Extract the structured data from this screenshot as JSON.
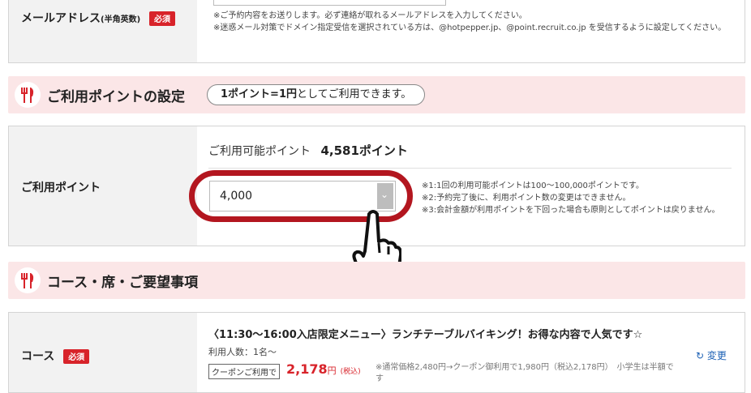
{
  "email": {
    "label": "メールアドレス",
    "label_small": "(半角英数)",
    "required": "必須",
    "note1": "※ご予約内容をお送りします。必ず連絡が取れるメールアドレスを入力してください。",
    "note2": "※迷惑メール対策でドメイン指定受信を選択されている方は、@hotpepper.jp、@point.recruit.co.jp を受信するように設定してください。"
  },
  "points_section": {
    "title": "ご利用ポイントの設定",
    "pill_bold": "1ポイント=1円",
    "pill_rest": "としてご利用できます。"
  },
  "points_row": {
    "label": "ご利用ポイント",
    "available_label": "ご利用可能ポイント",
    "available_value": "4,581ポイント",
    "selected_value": "4,000",
    "note1": "※1:1回の利用可能ポイントは100〜100,000ポイントです。",
    "note2": "※2:予約完了後に、利用ポイント数の変更はできません。",
    "note3": "※3:会計金額が利用ポイントを下回った場合も原則としてポイントは戻りません。"
  },
  "course_section": {
    "title": "コース・席・ご要望事項"
  },
  "course_row": {
    "label": "コース",
    "required": "必須",
    "name": "〈11:30〜16:00入店限定メニュー〉ランチテーブルバイキング！お得な内容で人気です☆",
    "people": "利用人数：1名〜",
    "coupon_tag": "クーポンご利用で",
    "price": "2,178",
    "yen": "円",
    "tax": "(税込)",
    "price_note": "※通常価格2,480円→クーポン御利用で1,980円（税込2,178円）　小学生は半額です",
    "change": "変更"
  },
  "colors": {
    "accent_red": "#d8232a",
    "pink_bg": "#fbe6e7",
    "label_bg": "#f2f2f2",
    "link_blue": "#1a5fb4",
    "ring": "#b3161f"
  }
}
